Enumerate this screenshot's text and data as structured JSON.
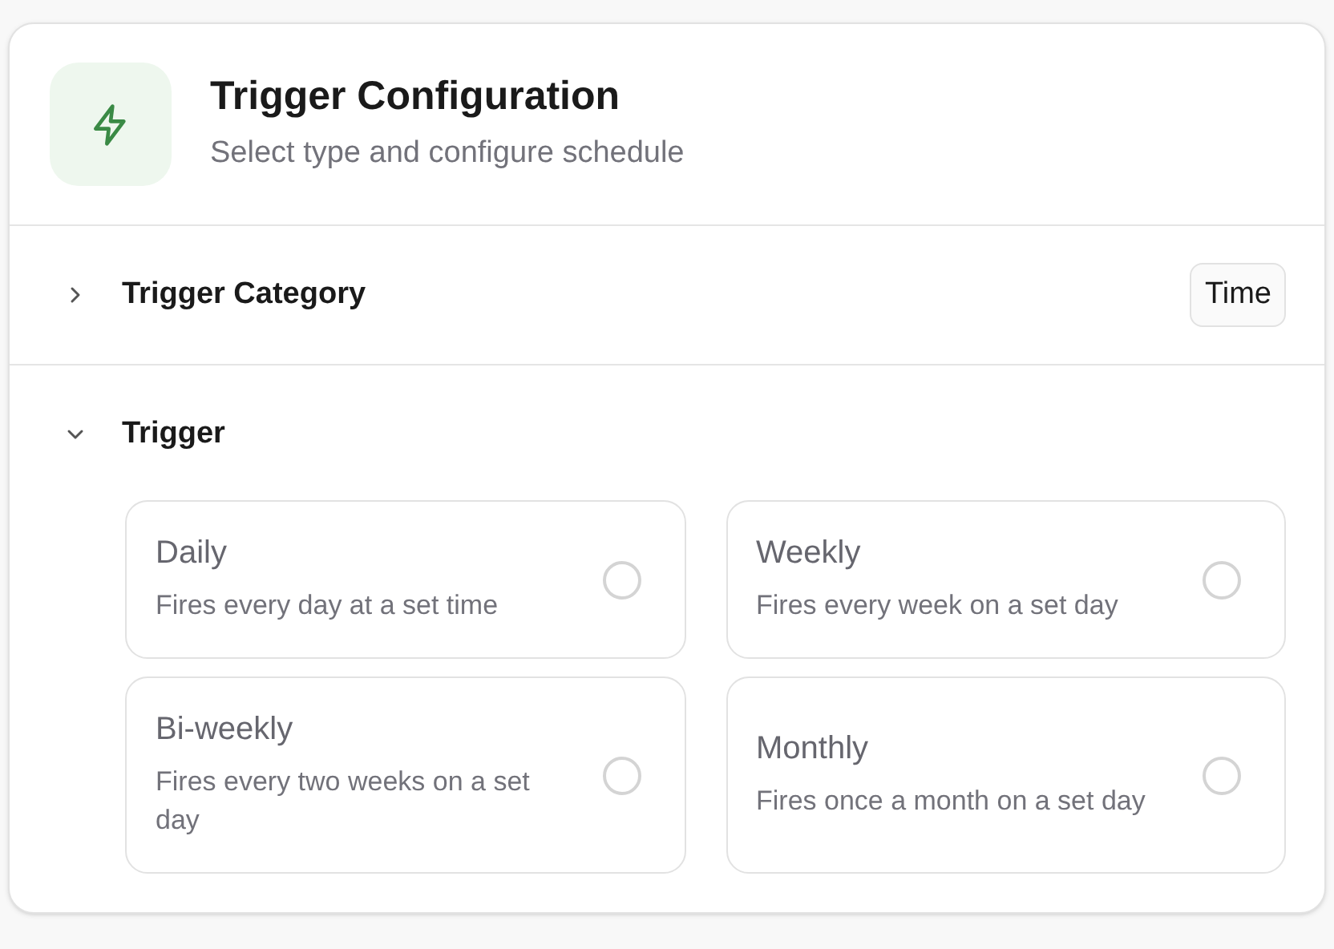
{
  "header": {
    "title": "Trigger Configuration",
    "subtitle": "Select type and configure schedule"
  },
  "sections": [
    {
      "label": "Trigger Category",
      "expanded": false,
      "value": "Time"
    },
    {
      "label": "Trigger",
      "expanded": true,
      "options": [
        {
          "title": "Daily",
          "description": "Fires every day at a set time",
          "selected": false
        },
        {
          "title": "Weekly",
          "description": "Fires every week on a set day",
          "selected": false
        },
        {
          "title": "Bi-weekly",
          "description": "Fires every two weeks on a set day",
          "selected": false
        },
        {
          "title": "Monthly",
          "description": "Fires once a month on a set day",
          "selected": false
        }
      ]
    }
  ]
}
